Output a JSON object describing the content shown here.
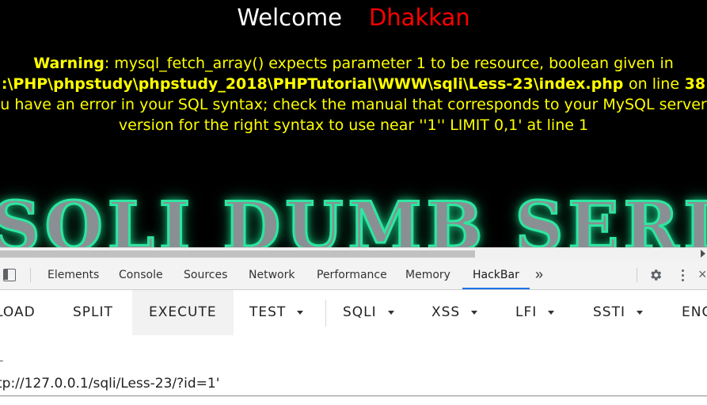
{
  "page": {
    "welcome_label": "Welcome",
    "welcome_name": "Dhakkan",
    "warning_label": "Warning",
    "warning_text": ": mysql_fetch_array() expects parameter 1 to be resource, boolean given in",
    "warning_path": ":\\PHP\\phpstudy\\phpstudy_2018\\PHPTutorial\\WWW\\sqli\\Less-23\\index.php",
    "on_line_label": "on line",
    "line_number": "38",
    "sql_error_line1": "u have an error in your SQL syntax; check the manual that corresponds to your MySQL server",
    "sql_error_line2": "version for the right syntax to use near ''1'' LIMIT 0,1' at line 1",
    "banner_text": "SQLI DUMB SERIES",
    "colors": {
      "welcome": "#ffffff",
      "name": "#ff0000",
      "error": "#ffff00",
      "banner_glow": "#2ee6a0"
    }
  },
  "devtools": {
    "tabs": [
      "Elements",
      "Console",
      "Sources",
      "Network",
      "Performance",
      "Memory",
      "HackBar"
    ],
    "active_tab": "HackBar",
    "more_tabs_glyph": "»",
    "icons": [
      "dock-side-icon",
      "more-tabs-icon",
      "settings-gear-icon",
      "kebab-menu-icon",
      "close-icon"
    ],
    "accent": "#1a73e8"
  },
  "hackbar": {
    "buttons": {
      "load": "LOAD",
      "split": "SPLIT",
      "execute": "EXECUTE",
      "test": "TEST",
      "sqli": "SQLI",
      "xss": "XSS",
      "lfi": "LFI",
      "ssti": "SSTI",
      "enc": "ENC"
    },
    "url_label": "L",
    "url_value": "tp://127.0.0.1/sqli/Less-23/?id=1'"
  }
}
